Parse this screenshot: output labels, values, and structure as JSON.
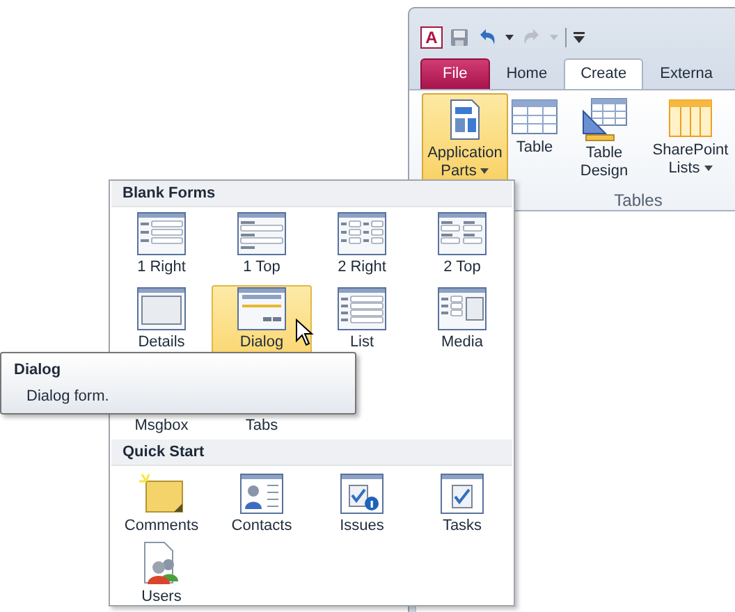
{
  "quick_access": {
    "logo": "A",
    "redo_disabled": true
  },
  "tabs": [
    {
      "label": "File",
      "kind": "file",
      "selected": false
    },
    {
      "label": "Home",
      "kind": "tab",
      "selected": false
    },
    {
      "label": "Create",
      "kind": "tab",
      "selected": true
    },
    {
      "label": "Externa",
      "kind": "tab",
      "selected": false
    }
  ],
  "ribbon": {
    "group": "Tables",
    "buttons": [
      {
        "label": "Application Parts",
        "dropdown": true,
        "pressed": true
      },
      {
        "label": "Table",
        "dropdown": false,
        "pressed": false
      },
      {
        "label": "Table Design",
        "dropdown": false,
        "pressed": false
      },
      {
        "label": "SharePoint Lists",
        "dropdown": true,
        "pressed": false
      }
    ]
  },
  "gallery": {
    "sections": [
      {
        "title": "Blank Forms",
        "kind": "forms",
        "items": [
          {
            "label": "1 Right",
            "selected": false
          },
          {
            "label": "1 Top",
            "selected": false
          },
          {
            "label": "2 Right",
            "selected": false
          },
          {
            "label": "2 Top",
            "selected": false
          },
          {
            "label": "Details",
            "selected": false
          },
          {
            "label": "Dialog",
            "selected": true
          },
          {
            "label": "List",
            "selected": false
          },
          {
            "label": "Media",
            "selected": false
          },
          {
            "label": "Msgbox",
            "selected": false
          },
          {
            "label": "Tabs",
            "selected": false
          }
        ]
      },
      {
        "title": "Quick Start",
        "kind": "quick",
        "items": [
          {
            "label": "Comments",
            "selected": false
          },
          {
            "label": "Contacts",
            "selected": false
          },
          {
            "label": "Issues",
            "selected": false
          },
          {
            "label": "Tasks",
            "selected": false
          },
          {
            "label": "Users",
            "selected": false
          }
        ]
      }
    ]
  },
  "tooltip": {
    "title": "Dialog",
    "text": "Dialog form."
  }
}
